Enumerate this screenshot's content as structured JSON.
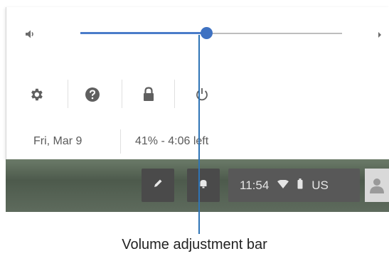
{
  "volume": {
    "icon": "speaker-icon",
    "level_percent": 48,
    "expand_icon": "chevron-right-icon"
  },
  "settings_row": {
    "icons": [
      "gear-icon",
      "help-icon",
      "lock-icon",
      "power-icon"
    ]
  },
  "info_row": {
    "date": "Fri, Mar 9",
    "battery": "41% - 4:06 left"
  },
  "shelf": {
    "pen_icon": "stylus-icon",
    "notification_icon": "bell-icon",
    "time": "11:54",
    "wifi_icon": "wifi-icon",
    "battery_icon": "battery-icon",
    "input_method": "US",
    "avatar_icon": "user-avatar-icon"
  },
  "colors": {
    "accent": "#3f72c2",
    "track": "#bdbdbd",
    "shelf": "#4d5a4c",
    "callout": "#2f74b5"
  },
  "callout": {
    "label": "Volume adjustment bar"
  }
}
